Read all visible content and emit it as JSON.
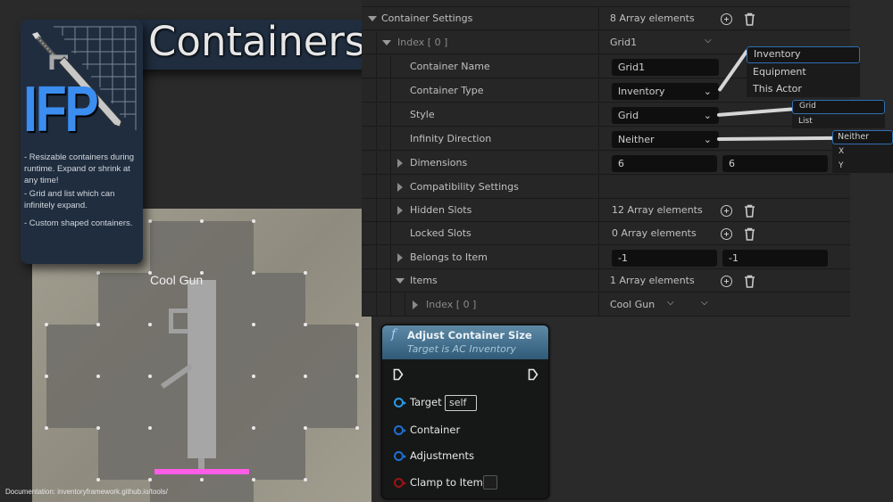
{
  "banner": {
    "title": "Containers",
    "logo_text": "IFP",
    "features": [
      "- Resizable containers during runtime. Expand or shrink at any time!",
      "- Grid and list which can infinitely expand.",
      "- Custom shaped containers."
    ]
  },
  "viewport": {
    "item_label": "Cool Gun",
    "documentation": "Documentation: inventoryframework.github.io/tools/"
  },
  "details": {
    "rows": [
      {
        "label": "Container Settings",
        "value": "8 Array elements"
      },
      {
        "label": "Index [ 0 ]",
        "value": "Grid1"
      },
      {
        "label": "Container Name",
        "value": "Grid1"
      },
      {
        "label": "Container Type",
        "value": "Inventory"
      },
      {
        "label": "Style",
        "value": "Grid"
      },
      {
        "label": "Infinity Direction",
        "value": "Neither"
      },
      {
        "label": "Dimensions",
        "value_x": "6",
        "value_y": "6"
      },
      {
        "label": "Compatibility Settings"
      },
      {
        "label": "Hidden Slots",
        "value": "12 Array elements"
      },
      {
        "label": "Locked Slots",
        "value": "0 Array elements"
      },
      {
        "label": "Belongs to Item",
        "value_x": "-1",
        "value_y": "-1"
      },
      {
        "label": "Items",
        "value": "1 Array elements"
      },
      {
        "label": "Index [ 0 ]",
        "value": "Cool Gun"
      }
    ],
    "popups": {
      "container_type": [
        "Inventory",
        "Equipment",
        "This Actor"
      ],
      "style": [
        "Grid",
        "List"
      ],
      "infinity_direction": [
        "Neither",
        "X",
        "Y"
      ]
    }
  },
  "node": {
    "title": "Adjust Container Size",
    "subtitle": "Target is AC Inventory",
    "function_glyph": "f",
    "pins": {
      "target": "Target",
      "target_default": "self",
      "container": "Container",
      "adjustments": "Adjustments",
      "clamp": "Clamp to Items"
    },
    "clamp_checked": false
  }
}
